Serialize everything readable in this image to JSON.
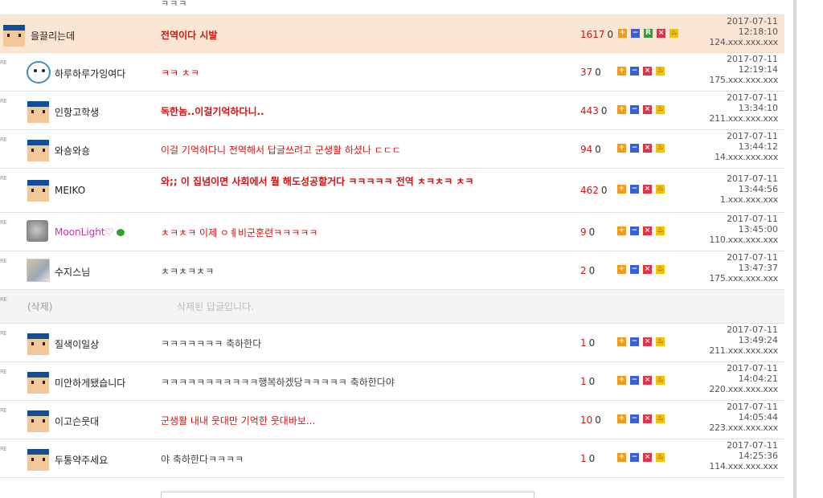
{
  "top_stub": "ㅋㅋㅋ",
  "re_label": "RE",
  "comments": [
    {
      "nick": "을끌리는데",
      "content": "전역이다 시발",
      "style": "bold",
      "views": "1617",
      "zero": "0",
      "buttons": [
        "+",
        "−",
        "R",
        "×",
        "♨"
      ],
      "date": "2017-07-11",
      "time": "12:18:10",
      "ip": "124.xxx.xxx.xxx"
    },
    {
      "nick": "하루하루가잉여다",
      "content": "ㅋㅋ ㅊㅋ",
      "style": "red",
      "views": "37",
      "zero": "0",
      "buttons": [
        "+",
        "−",
        "×",
        "♨"
      ],
      "date": "2017-07-11",
      "time": "12:19:14",
      "ip": "175.xxx.xxx.xxx"
    },
    {
      "nick": "인항고학생",
      "content": "독한놈..이걸기억하다니..",
      "style": "bold",
      "views": "443",
      "zero": "0",
      "buttons": [
        "+",
        "−",
        "×",
        "♨"
      ],
      "date": "2017-07-11",
      "time": "13:34:10",
      "ip": "211.xxx.xxx.xxx"
    },
    {
      "nick": "와숑와숑",
      "content": "이걸 기억하다니 전역해서 답글쓰려고 군생활 하셨나 ㄷㄷㄷ",
      "style": "red",
      "views": "94",
      "zero": "0",
      "buttons": [
        "+",
        "−",
        "×",
        "♨"
      ],
      "date": "2017-07-11",
      "time": "13:44:12",
      "ip": "14.xxx.xxx.xxx"
    },
    {
      "nick": "MEIKO",
      "content": "와;; 이 집념이면 사회에서 뭘 해도성공할거다 ㅋㅋㅋㅋㅋ 전역 ㅊㅋㅊㅋ ㅊㅋ",
      "style": "bold",
      "views": "462",
      "zero": "0",
      "buttons": [
        "+",
        "−",
        "×",
        "♨"
      ],
      "date": "2017-07-11",
      "time": "13:44:56",
      "ip": "1.xxx.xxx.xxx"
    },
    {
      "nick": "MoonLight♡",
      "content": "ㅊㅋㅊㅋ 이제 ㅇㅖ비군훈련ㅋㅋㅋㅋㅋ",
      "style": "red",
      "views": "9",
      "zero": "0",
      "buttons": [
        "+",
        "−",
        "×",
        "♨"
      ],
      "date": "2017-07-11",
      "time": "13:45:00",
      "ip": "110.xxx.xxx.xxx"
    },
    {
      "nick": "수지스님",
      "content": "ㅊㅋㅊㅋㅊㅋ",
      "style": "plain",
      "views": "2",
      "zero": "0",
      "buttons": [
        "+",
        "−",
        "×",
        "♨"
      ],
      "date": "2017-07-11",
      "time": "13:47:37",
      "ip": "175.xxx.xxx.xxx"
    },
    {
      "deleted_label": "(삭제)",
      "deleted_text": "삭제된 답글입니다."
    },
    {
      "nick": "질색이일상",
      "content": "ㅋㅋㅋㅋㅋㅋㅋ 축하한다",
      "style": "plain",
      "views": "1",
      "zero": "0",
      "buttons": [
        "+",
        "−",
        "×",
        "♨"
      ],
      "date": "2017-07-11",
      "time": "13:49:24",
      "ip": "211.xxx.xxx.xxx"
    },
    {
      "nick": "미안하게됐습니다",
      "content": "ㅋㅋㅋㅋㅋㅋㅋㅋㅋㅋㅋ행복하겠당ㅋㅋㅋㅋㅋ 축하한다야",
      "style": "plain",
      "views": "1",
      "zero": "0",
      "buttons": [
        "+",
        "−",
        "×",
        "♨"
      ],
      "date": "2017-07-11",
      "time": "14:04:21",
      "ip": "220.xxx.xxx.xxx"
    },
    {
      "nick": "이고슨웃대",
      "content": "군생활 내내 웃대만 기억한 웃대바보...",
      "style": "red",
      "views": "10",
      "zero": "0",
      "buttons": [
        "+",
        "−",
        "×",
        "♨"
      ],
      "date": "2017-07-11",
      "time": "14:05:44",
      "ip": "223.xxx.xxx.xxx"
    },
    {
      "nick": "두통약주세요",
      "content": "야 축하한다ㅋㅋㅋㅋ",
      "style": "plain",
      "views": "1",
      "zero": "0",
      "buttons": [
        "+",
        "−",
        "×",
        "♨"
      ],
      "date": "2017-07-11",
      "time": "14:25:36",
      "ip": "114.xxx.xxx.xxx"
    }
  ]
}
